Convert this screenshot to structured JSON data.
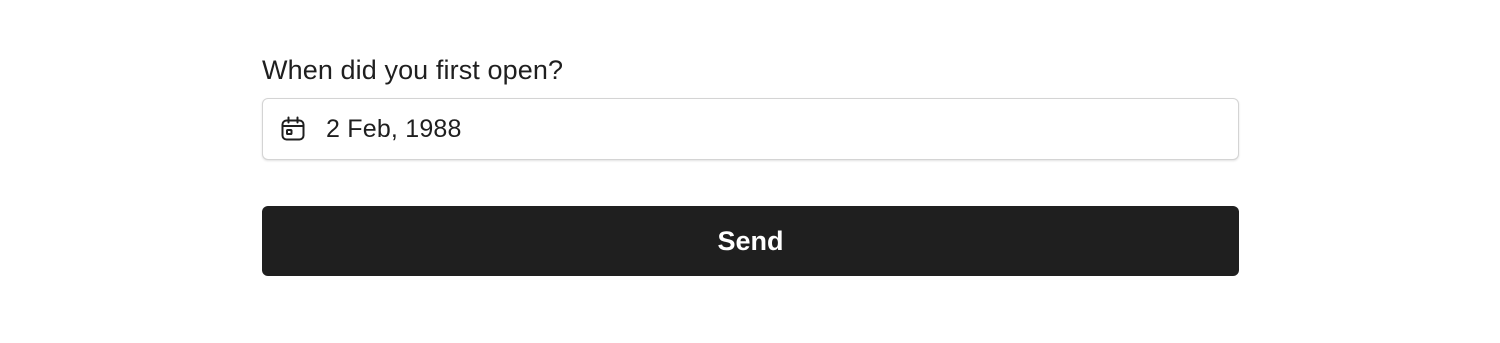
{
  "form": {
    "question": {
      "label": "When did you first open?"
    },
    "date_field": {
      "icon": "calendar-icon",
      "value": "2 Feb, 1988"
    },
    "submit": {
      "label": "Send"
    }
  },
  "colors": {
    "text": "#1f1f1f",
    "field_border": "#d4d4d4",
    "button_background": "#1f1f1f",
    "button_text": "#ffffff"
  }
}
